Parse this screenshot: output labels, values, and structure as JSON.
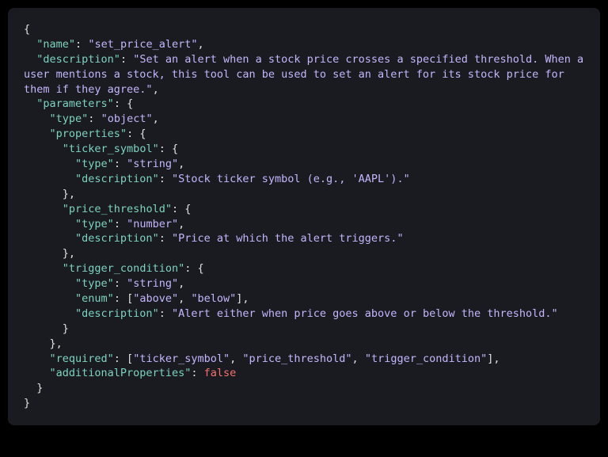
{
  "code": {
    "name_key": "\"name\"",
    "name_val": "\"set_price_alert\"",
    "description_key": "\"description\"",
    "description_val": "\"Set an alert when a stock price crosses a specified threshold. When a user mentions a stock, this tool can be used to set an alert for its stock price for them if they agree.\"",
    "parameters_key": "\"parameters\"",
    "type_key": "\"type\"",
    "type_object": "\"object\"",
    "properties_key": "\"properties\"",
    "ticker_symbol_key": "\"ticker_symbol\"",
    "type_string": "\"string\"",
    "ticker_desc": "\"Stock ticker symbol (e.g., 'AAPL').\"",
    "price_threshold_key": "\"price_threshold\"",
    "type_number": "\"number\"",
    "price_desc": "\"Price at which the alert triggers.\"",
    "trigger_condition_key": "\"trigger_condition\"",
    "enum_key": "\"enum\"",
    "enum_above": "\"above\"",
    "enum_below": "\"below\"",
    "trigger_desc": "\"Alert either when price goes above or below the threshold.\"",
    "required_key": "\"required\"",
    "req_ticker": "\"ticker_symbol\"",
    "req_price": "\"price_threshold\"",
    "req_trigger": "\"trigger_condition\"",
    "additionalProperties_key": "\"additionalProperties\"",
    "false_val": "false"
  }
}
